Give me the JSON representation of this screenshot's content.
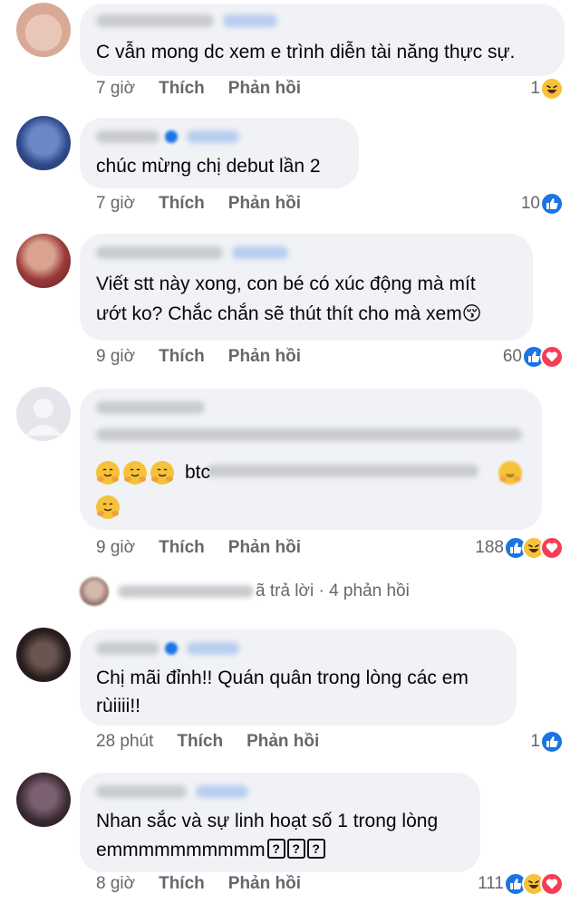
{
  "comments": [
    {
      "text_lines": [
        "C vẫn mong dc xem e trình diễn tài năng thực sự."
      ],
      "time": "7 giờ",
      "like_label": "Thích",
      "reply_label": "Phản hồi",
      "reaction_count": "1",
      "reactions": [
        "haha"
      ]
    },
    {
      "text_lines": [
        "chúc mừng chị debut lần 2"
      ],
      "time": "7 giờ",
      "like_label": "Thích",
      "reply_label": "Phản hồi",
      "reaction_count": "10",
      "reactions": [
        "like"
      ]
    },
    {
      "text_lines": [
        "Viết stt này xong, con bé có xúc động mà mít",
        "ướt ko? Chắc chắn sẽ thút thít cho mà xem😚"
      ],
      "time": "9 giờ",
      "like_label": "Thích",
      "reply_label": "Phản hồi",
      "reaction_count": "60",
      "reactions": [
        "like",
        "love"
      ]
    },
    {
      "text_lines": [
        "btc"
      ],
      "time": "9 giờ",
      "like_label": "Thích",
      "reply_label": "Phản hồi",
      "reaction_count": "188",
      "reactions": [
        "like",
        "haha",
        "love"
      ]
    },
    {
      "text_lines": [
        "Chị mãi đỉnh!! Quán quân trong lòng các em",
        "rùiiii!!"
      ],
      "time": "28 phút",
      "like_label": "Thích",
      "reply_label": "Phản hồi",
      "reaction_count": "1",
      "reactions": [
        "like"
      ]
    },
    {
      "text_lines": [
        "Nhan sắc và sự linh hoạt số 1 trong lòng",
        "emmmmmmmmmm"
      ],
      "time": "8 giờ",
      "like_label": "Thích",
      "reply_label": "Phản hồi",
      "reaction_count": "111",
      "reactions": [
        "like",
        "haha",
        "love"
      ]
    }
  ],
  "replies_summary": "ã trả lời · 4 phản hồi",
  "question_glyph": "?",
  "colors": {
    "bubble": "#f0f2f5",
    "meta_text": "#65676b",
    "like_blue": "#1b74e4",
    "love_red": "#f33e58",
    "haha_yellow": "#f7c23a"
  }
}
